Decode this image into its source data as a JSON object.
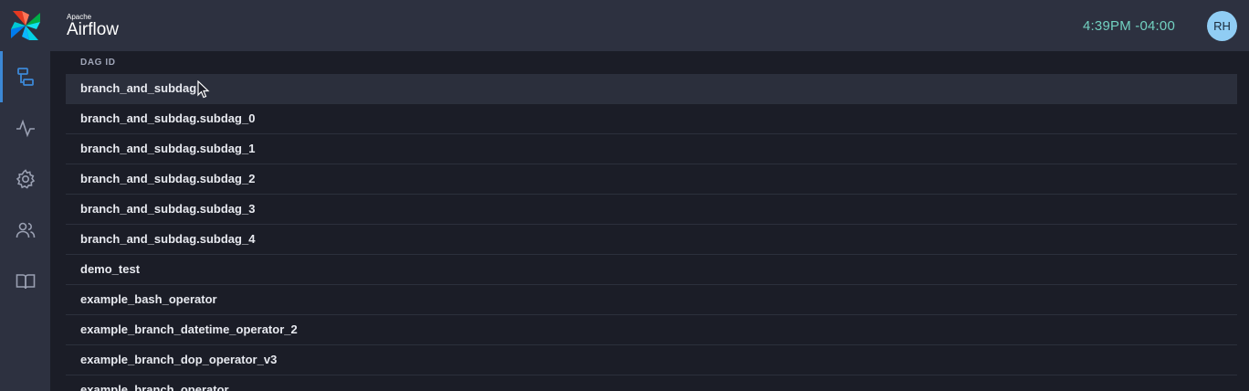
{
  "header": {
    "brand_small": "Apache",
    "brand_large": "Airflow",
    "time": "4:39PM -04:00",
    "avatar_initials": "RH"
  },
  "sidebar": {
    "items": [
      {
        "name": "dags",
        "icon": "dag-list-icon",
        "active": true
      },
      {
        "name": "activity",
        "icon": "activity-icon",
        "active": false
      },
      {
        "name": "settings",
        "icon": "gear-icon",
        "active": false
      },
      {
        "name": "users",
        "icon": "users-icon",
        "active": false
      },
      {
        "name": "docs",
        "icon": "book-icon",
        "active": false
      }
    ]
  },
  "table": {
    "column_header": "DAG ID",
    "rows": [
      "branch_and_subdag",
      "branch_and_subdag.subdag_0",
      "branch_and_subdag.subdag_1",
      "branch_and_subdag.subdag_2",
      "branch_and_subdag.subdag_3",
      "branch_and_subdag.subdag_4",
      "demo_test",
      "example_bash_operator",
      "example_branch_datetime_operator_2",
      "example_branch_dop_operator_v3",
      "example_branch_operator"
    ]
  },
  "colors": {
    "accent": "#3c88d6",
    "clock": "#72d1c1",
    "avatar_bg": "#90cdf4",
    "icon": "#9aa0b2"
  }
}
